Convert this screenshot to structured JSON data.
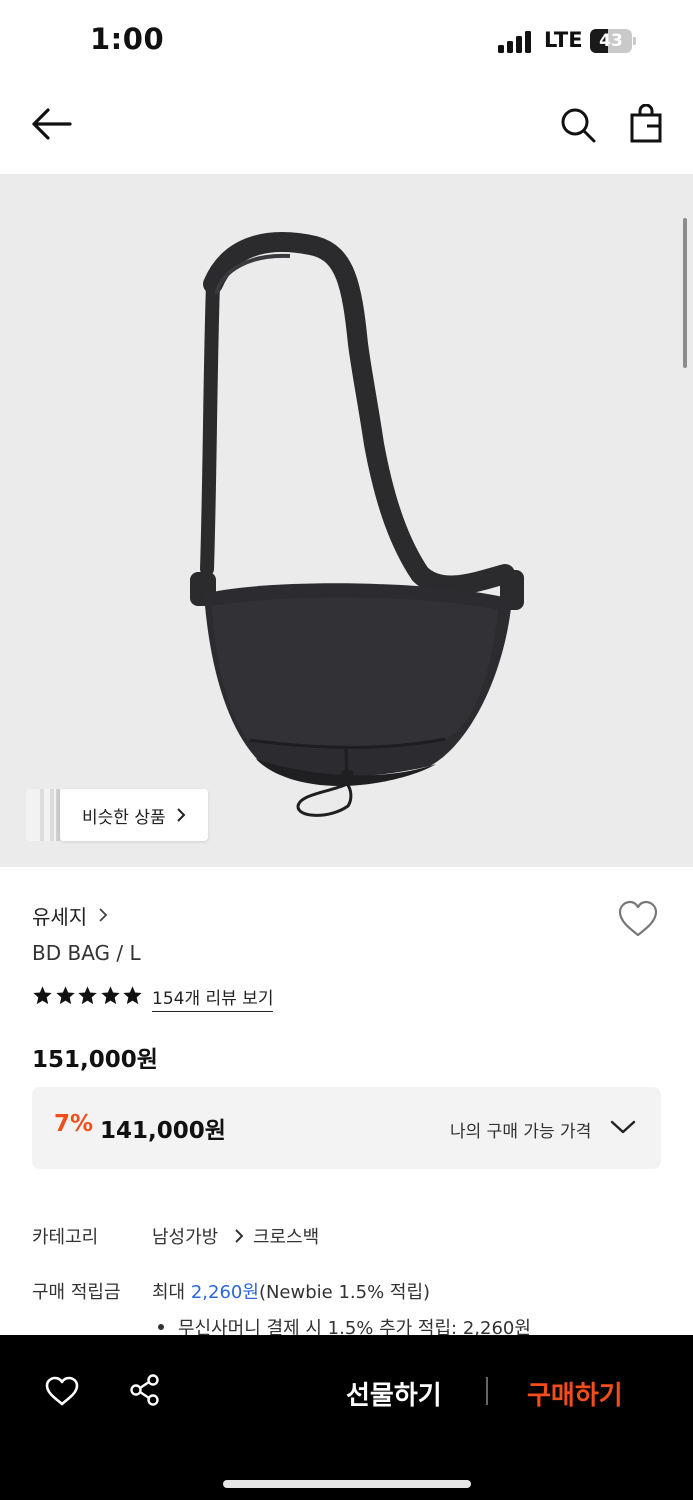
{
  "status_bar": {
    "time": "1:00",
    "network": "LTE",
    "battery": "43",
    "battery_level": 0.43
  },
  "nav": {
    "back_icon": "arrow-left-icon",
    "search_icon": "search-icon",
    "cart_icon": "shopping-bag-icon"
  },
  "product_image": {
    "alt": "black crossbody bag",
    "similar_button": "비슷한 상품"
  },
  "product": {
    "brand": "유세지",
    "name": "BD BAG / L",
    "rating_stars": 5,
    "review_link": "154개 리뷰 보기",
    "price": "151,000원"
  },
  "price_box": {
    "discount": "7%",
    "sale_price": "141,000원",
    "my_price_label": "나의 구매 가능 가격"
  },
  "info": {
    "category_label": "카테고리",
    "category_main": "남성가방",
    "category_sub": "크로스백",
    "points_label": "구매 적립금",
    "points_prefix": "최대 ",
    "points_amount": "2,260원",
    "points_suffix": "(Newbie 1.5% 적립)",
    "points_bullet": "무신사머니 결제 시 1.5% 추가 적립: 2,260원"
  },
  "bottom_bar": {
    "gift_label": "선물하기",
    "buy_label": "구매하기"
  },
  "colors": {
    "accent_orange": "#f14e1c",
    "link_blue": "#2c66d8",
    "bottom_bar_bg": "#000000"
  }
}
